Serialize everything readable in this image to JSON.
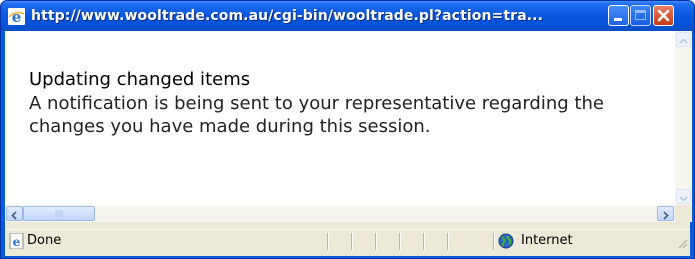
{
  "window": {
    "title": "http://www.wooltrade.com.au/cgi-bin/wooltrade.pl?action=tra...",
    "title_icon": "ie-icon",
    "controls": [
      "minimize-button",
      "maximize-button",
      "close-button"
    ]
  },
  "content": {
    "heading": "Updating changed items",
    "message": "A notification is being sent to your representative regarding the changes you have made during this session."
  },
  "statusbar": {
    "status_text": "Done",
    "status_icon": "ie-page-icon",
    "zone_text": "Internet",
    "zone_icon": "globe-icon"
  },
  "colors": {
    "titlebar": "#0a58e0",
    "chrome": "#ece9d8",
    "close_button": "#c53b18"
  }
}
